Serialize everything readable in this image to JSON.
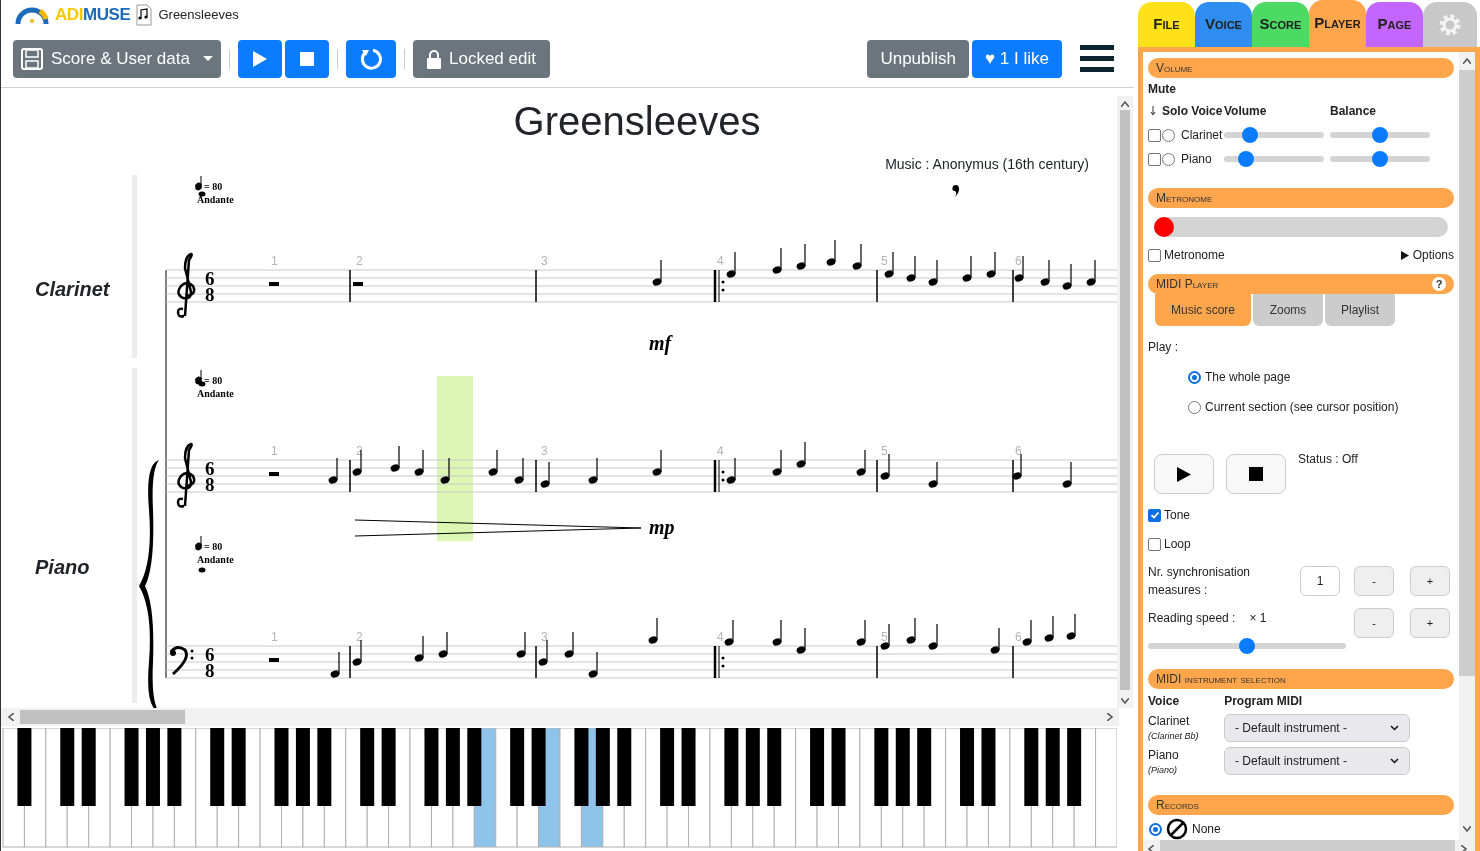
{
  "header": {
    "logo_parts": [
      "ADI",
      "MUSE"
    ],
    "document_name": "Greensleeves"
  },
  "toolbar": {
    "save_menu": "Score & User data",
    "locked_edit": "Locked edit",
    "unpublish": "Unpublish",
    "like": "♥ 1 I like"
  },
  "score": {
    "title": "Greensleeves",
    "composer": "Music : Anonymus (16th century)",
    "systems": [
      {
        "instrument": "Clarinet",
        "staves": [
          {
            "kind": "treble",
            "tempo": "= 80",
            "tempo_text": "Andante",
            "time_signature": [
              "6",
              "8"
            ],
            "measure_numbers": [
              "1",
              "2",
              "3",
              "4",
              "5",
              "6"
            ],
            "dynamic": "mf"
          }
        ]
      },
      {
        "instrument": "Piano",
        "staves": [
          {
            "kind": "treble",
            "tempo": "= 80",
            "tempo_text": "Andante",
            "time_signature": [
              "6",
              "8"
            ],
            "measure_numbers": [
              "1",
              "2",
              "3",
              "4",
              "5",
              "6"
            ],
            "dynamic": "mp"
          },
          {
            "kind": "bass",
            "tempo": "= 80",
            "tempo_text": "Andante",
            "time_signature": [
              "6",
              "8"
            ],
            "measure_numbers": [
              "1",
              "2",
              "3",
              "4",
              "5",
              "6"
            ]
          }
        ]
      }
    ]
  },
  "keyboard": {
    "white_keys": [
      {
        "pressed": false
      },
      {
        "pressed": false
      },
      {
        "pressed": false
      },
      {
        "pressed": false
      },
      {
        "pressed": false
      },
      {
        "pressed": false
      },
      {
        "pressed": false
      },
      {
        "pressed": false
      },
      {
        "pressed": false
      },
      {
        "pressed": false
      },
      {
        "pressed": false
      },
      {
        "pressed": false
      },
      {
        "pressed": false
      },
      {
        "pressed": false
      },
      {
        "pressed": false
      },
      {
        "pressed": false
      },
      {
        "pressed": false
      },
      {
        "pressed": false
      },
      {
        "pressed": false
      },
      {
        "pressed": false
      },
      {
        "pressed": false
      },
      {
        "pressed": false
      },
      {
        "pressed": true
      },
      {
        "pressed": false
      },
      {
        "pressed": false
      },
      {
        "pressed": true
      },
      {
        "pressed": false
      },
      {
        "pressed": true
      },
      {
        "pressed": false
      },
      {
        "pressed": false
      },
      {
        "pressed": false
      },
      {
        "pressed": false
      },
      {
        "pressed": false
      },
      {
        "pressed": false
      },
      {
        "pressed": false
      },
      {
        "pressed": false
      },
      {
        "pressed": false
      },
      {
        "pressed": false
      },
      {
        "pressed": false
      },
      {
        "pressed": false
      },
      {
        "pressed": false
      },
      {
        "pressed": false
      },
      {
        "pressed": false
      },
      {
        "pressed": false
      },
      {
        "pressed": false
      },
      {
        "pressed": false
      },
      {
        "pressed": false
      },
      {
        "pressed": false
      },
      {
        "pressed": false
      },
      {
        "pressed": false
      },
      {
        "pressed": false
      },
      {
        "pressed": false
      }
    ]
  },
  "panel": {
    "tabs": [
      {
        "kind": "text",
        "label": "File",
        "color": "#ffe11a",
        "selected": false
      },
      {
        "kind": "text",
        "label": "Voice",
        "color": "#2f8cf0",
        "selected": false
      },
      {
        "kind": "text",
        "label": "Score",
        "color": "#4cd964",
        "selected": false
      },
      {
        "kind": "text",
        "label": "Player",
        "color": "#ffa64d",
        "selected": true
      },
      {
        "kind": "text",
        "label": "Page",
        "color": "#c266ff",
        "selected": false
      },
      {
        "kind": "settings",
        "color": "#c8c8c8",
        "selected": false
      }
    ],
    "volume": {
      "header": "Volume",
      "mute_label": "Mute",
      "columns": [
        "Solo Voice",
        "Volume",
        "Balance"
      ],
      "voices": [
        {
          "name": "Clarinet",
          "muted": false,
          "solo": false,
          "volume": {
            "level": 0.21
          },
          "balance": {
            "level": 0.5
          }
        },
        {
          "name": "Piano",
          "muted": false,
          "solo": false,
          "volume": {
            "level": 0.17
          },
          "balance": {
            "level": 0.5
          }
        }
      ]
    },
    "metronome": {
      "header": "Metronome",
      "beat": {
        "level": 0
      },
      "checkbox": {
        "label": "Metronome",
        "checked": false
      },
      "options": {
        "label": "Options",
        "expanded": false
      }
    },
    "midi_player": {
      "header": "MIDI Player",
      "help": "?",
      "tabs": [
        {
          "label": "Music score",
          "selected": true
        },
        {
          "label": "Zooms",
          "selected": false
        },
        {
          "label": "Playlist",
          "selected": false
        }
      ],
      "play_label": "Play :",
      "play_options": [
        {
          "label": "The whole page",
          "selected": true
        },
        {
          "label": "Current section (see cursor position)",
          "selected": false
        }
      ],
      "status": "Status : Off",
      "tone": {
        "label": "Tone",
        "checked": true
      },
      "loop": {
        "label": "Loop",
        "checked": false
      },
      "sync": {
        "label": "Nr. synchronisation measures :",
        "value": "1",
        "minus": "-",
        "plus": "+"
      },
      "speed": {
        "label": "Reading speed :",
        "value": "× 1",
        "slider": {
          "level": 0.5
        },
        "minus": "-",
        "plus": "+"
      }
    },
    "instruments": {
      "header": "MIDI instrument selection",
      "columns": [
        "Voice",
        "Program MIDI"
      ],
      "rows": [
        {
          "name": "Clarinet",
          "detail": "(Clarinet Bb)",
          "program": "- Default instrument -"
        },
        {
          "name": "Piano",
          "detail": "(Piano)",
          "program": "- Default instrument -"
        }
      ]
    },
    "records": {
      "header": "Records",
      "options": [
        {
          "label": "None",
          "selected": true
        }
      ]
    }
  }
}
